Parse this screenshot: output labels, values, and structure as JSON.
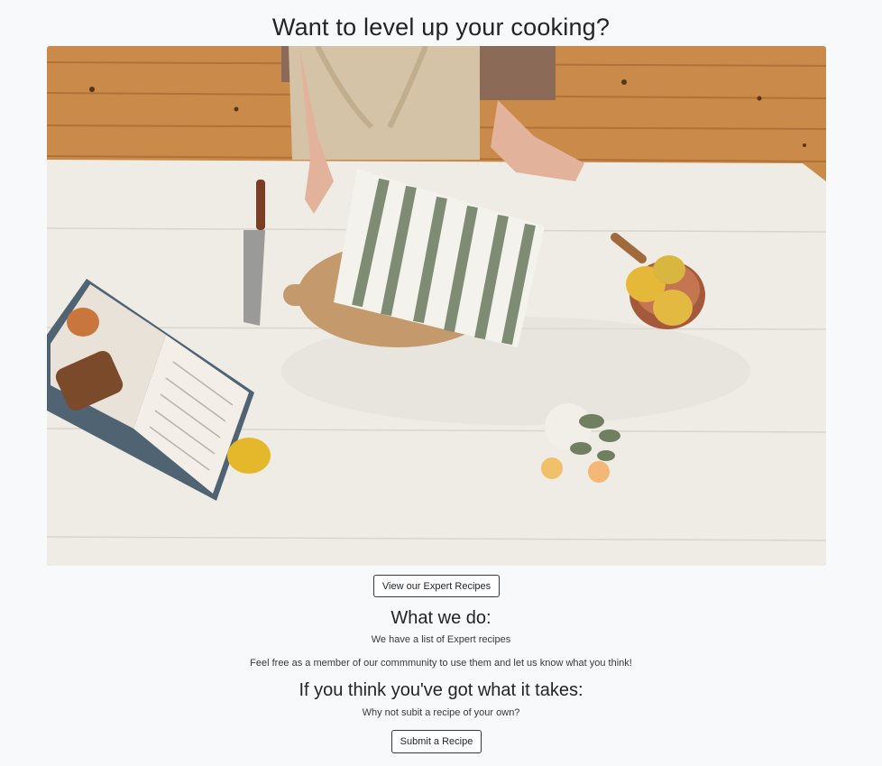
{
  "hero": {
    "title": "Want to level up your cooking?",
    "image_alt": "Overhead view of a person at a white wooden kitchen table with a knife, striped towel on a cutting board, an open cookbook, lemons and a small vase of flowers"
  },
  "actions": {
    "view_recipes_label": "View our Expert Recipes",
    "submit_recipe_label": "Submit a Recipe"
  },
  "about": {
    "heading": "What we do:",
    "line1": "We have a list of Expert recipes",
    "line2": "Feel free as a member of our commmunity to use them and let us know what you think!"
  },
  "contribute": {
    "heading": "If you think you've got what it takes:",
    "line1": "Why not subit a recipe of your own?"
  },
  "colors": {
    "background": "#f8f9fb",
    "text": "#212529",
    "button_border": "#343a40"
  }
}
